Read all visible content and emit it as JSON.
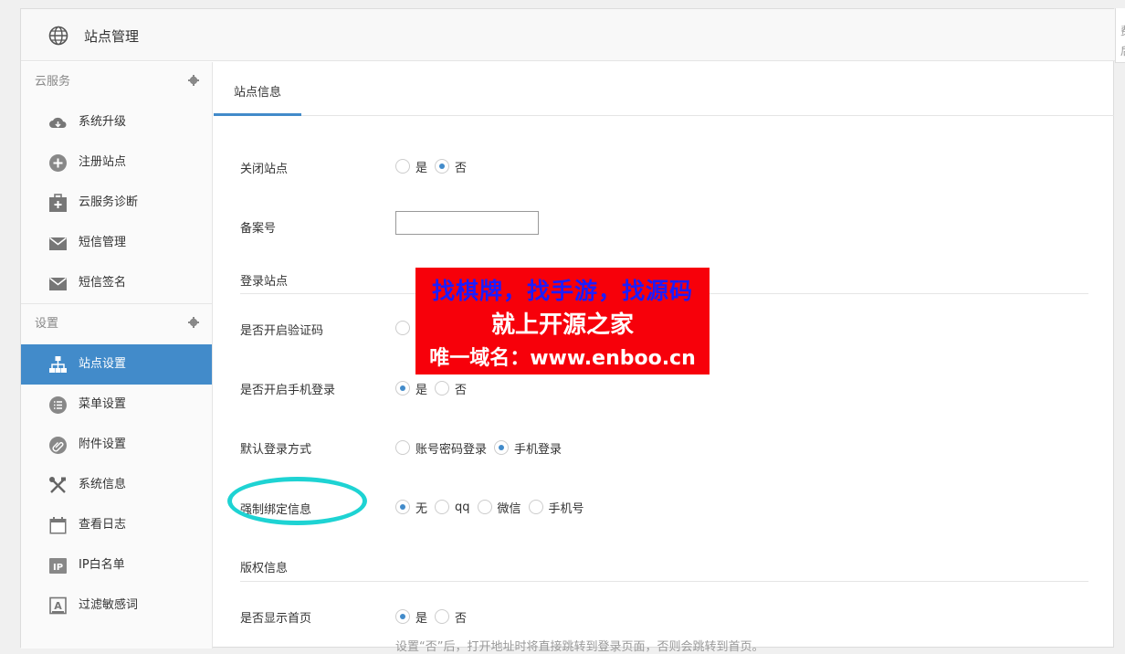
{
  "header": {
    "title": "站点管理",
    "icon": "globe-icon"
  },
  "right_edge_text": "费 后",
  "sidebar": {
    "sections": [
      {
        "title": "云服务",
        "items": [
          {
            "label": "系统升级",
            "icon": "cloud-download-icon"
          },
          {
            "label": "注册站点",
            "icon": "plus-circle-icon"
          },
          {
            "label": "云服务诊断",
            "icon": "medkit-icon"
          },
          {
            "label": "短信管理",
            "icon": "envelope-icon"
          },
          {
            "label": "短信签名",
            "icon": "envelope-icon"
          }
        ]
      },
      {
        "title": "设置",
        "items": [
          {
            "label": "站点设置",
            "icon": "sitemap-icon",
            "active": true
          },
          {
            "label": "菜单设置",
            "icon": "list-circle-icon"
          },
          {
            "label": "附件设置",
            "icon": "paperclip-circle-icon"
          },
          {
            "label": "系统信息",
            "icon": "tools-icon"
          },
          {
            "label": "查看日志",
            "icon": "calendar-icon"
          },
          {
            "label": "IP白名单",
            "icon": "ip-icon"
          },
          {
            "label": "过滤敏感词",
            "icon": "text-filter-icon"
          }
        ]
      }
    ]
  },
  "tabs": [
    {
      "label": "站点信息",
      "active": true
    }
  ],
  "form": {
    "close_site": {
      "label": "关闭站点",
      "options": [
        "是",
        "否"
      ],
      "selected": "否"
    },
    "icp": {
      "label": "备案号",
      "value": ""
    },
    "login_section": "登录站点",
    "captcha": {
      "label": "是否开启验证码"
    },
    "mobile_login": {
      "label": "是否开启手机登录",
      "options": [
        "是",
        "否"
      ],
      "selected": "是"
    },
    "default_login": {
      "label": "默认登录方式",
      "options": [
        "账号密码登录",
        "手机登录"
      ],
      "selected": "手机登录"
    },
    "force_bind": {
      "label": "强制绑定信息",
      "options": [
        "无",
        "qq",
        "微信",
        "手机号"
      ],
      "selected": "无"
    },
    "copyright_section": "版权信息",
    "show_home": {
      "label": "是否显示首页",
      "options": [
        "是",
        "否"
      ],
      "selected": "是"
    },
    "show_home_hint": "设置“否”后，打开地址时将直接跳转到登录页面，否则会跳转到首页。"
  },
  "banner": {
    "line1": "找棋牌，找手游，找源码",
    "line2": "就上开源之家",
    "line3": "唯一域名：www.enboo.cn"
  },
  "colors": {
    "accent": "#428bca",
    "banner_bg": "#f7000a",
    "banner_line1": "#1c1cff",
    "annotation": "#1ed3d3"
  }
}
